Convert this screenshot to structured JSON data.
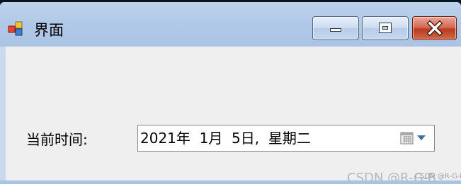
{
  "window": {
    "title": "界面",
    "app_icon": "windows-forms-app-icon"
  },
  "caption_buttons": {
    "minimize_icon": "minimize-icon",
    "maximize_icon": "maximize-icon",
    "close_icon": "close-icon"
  },
  "form": {
    "time_label": "当前时间:",
    "date_value": "2021年  1月  5日,  星期二",
    "calendar_icon": "calendar-icon",
    "dropdown_icon": "chevron-down-icon"
  },
  "watermark": {
    "text": "CSDN @R-G-B",
    "overlay": "CSDN @R-G-B"
  },
  "colors": {
    "title_bar": "#b2cae8",
    "close_button": "#c8452a",
    "client_background": "#efefef"
  }
}
